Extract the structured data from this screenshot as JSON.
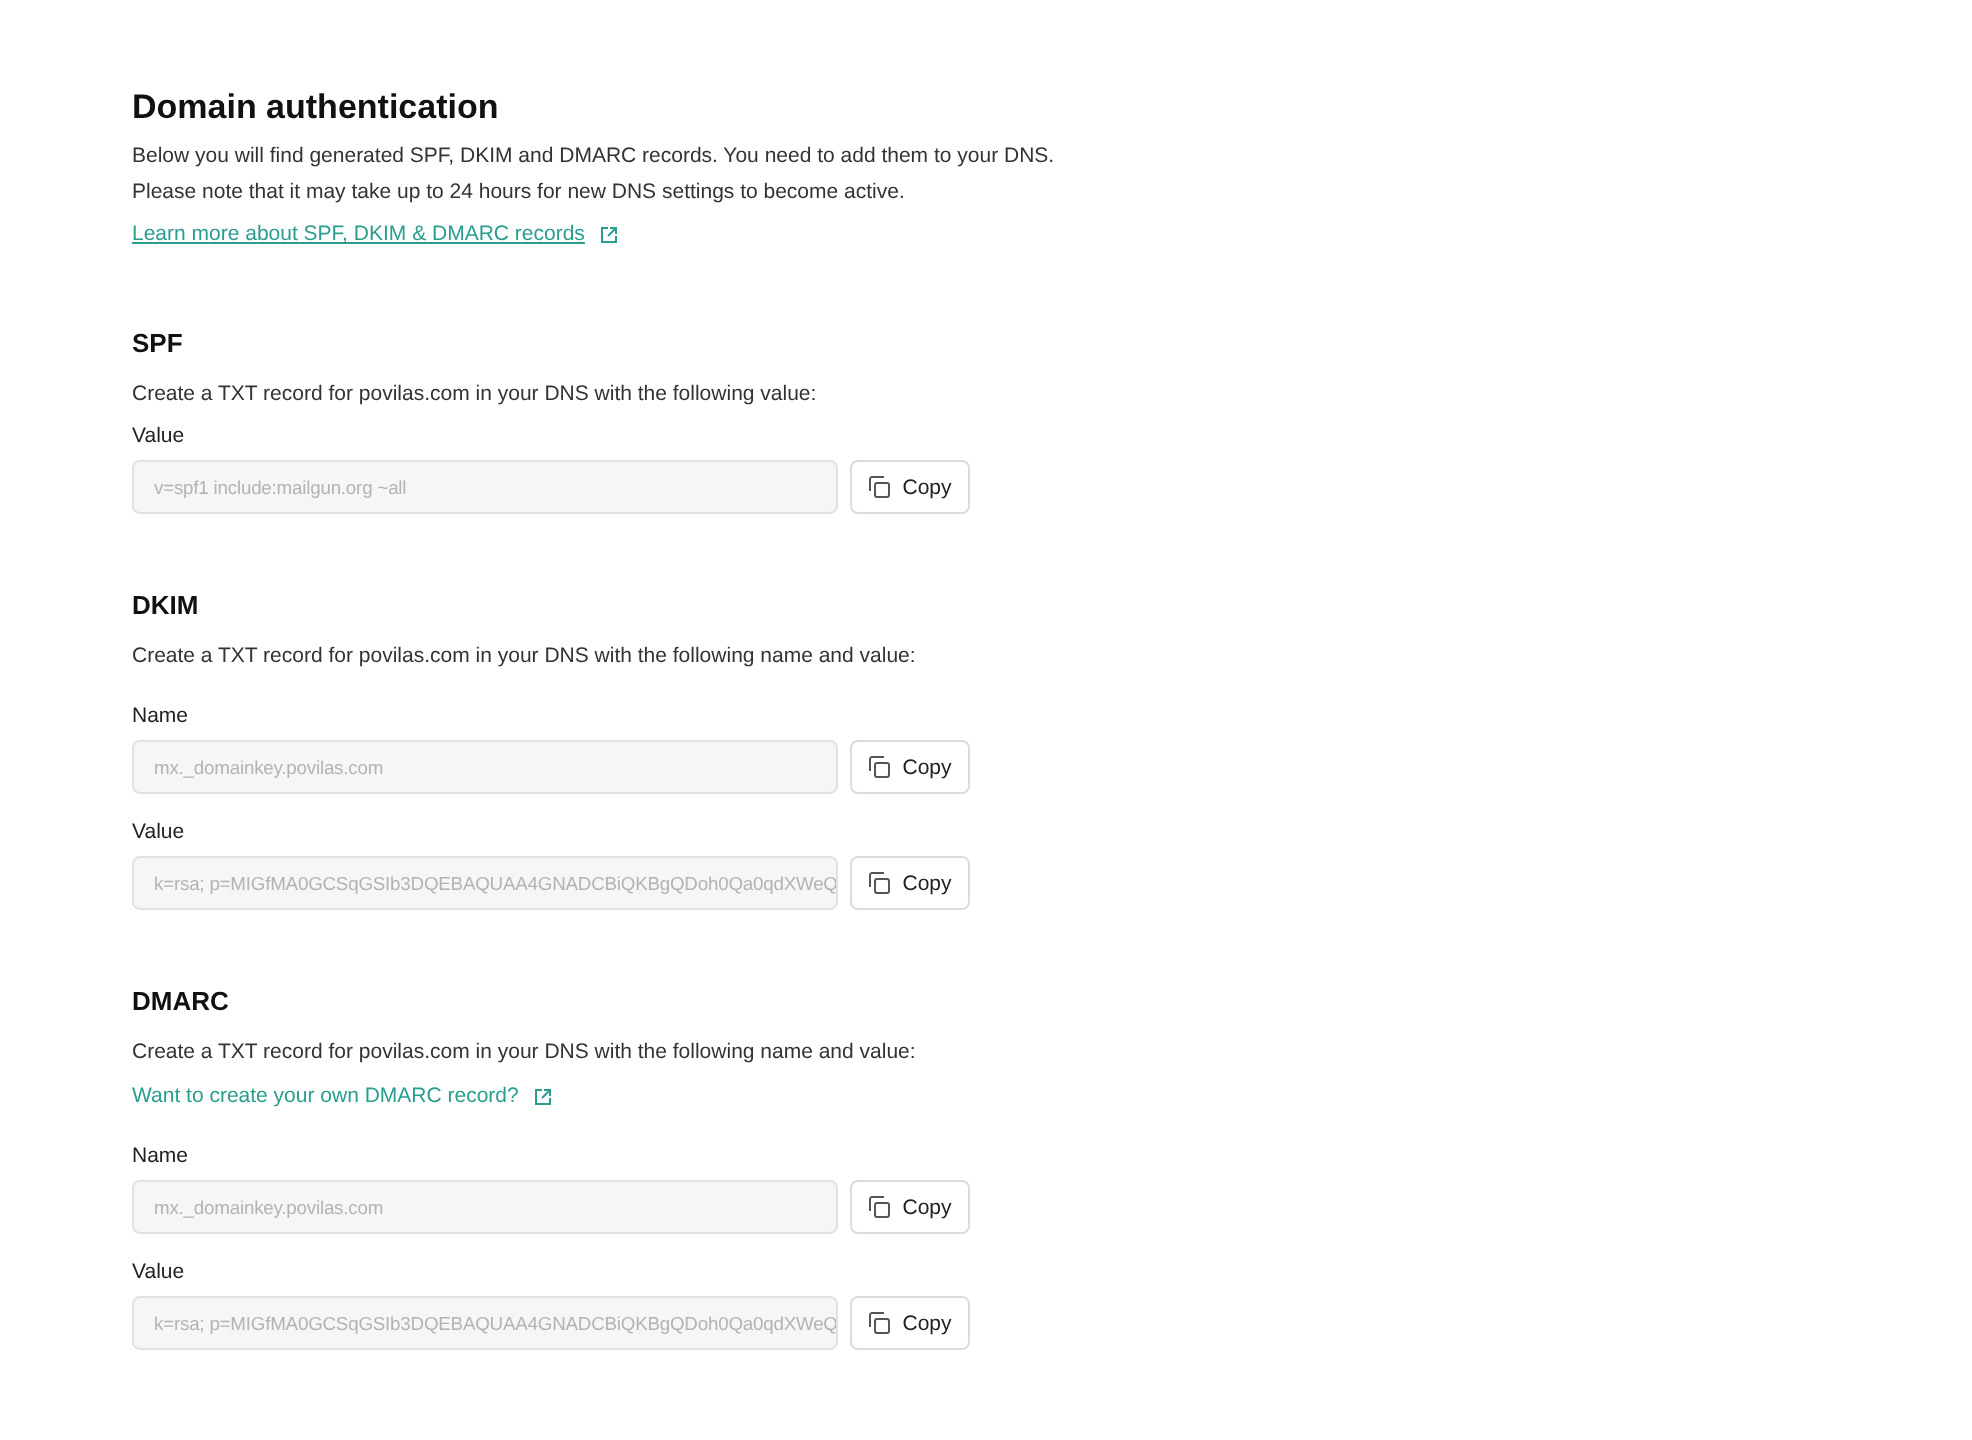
{
  "title": "Domain authentication",
  "intro": [
    "Below you will find generated SPF, DKIM and DMARC records. You need to add them to your DNS.",
    "Please note that it may take up to 24 hours for new DNS settings to become active."
  ],
  "intro_link": "Learn more about SPF, DKIM & DMARC records",
  "sections": [
    {
      "title": "SPF",
      "description": "Create a TXT record for povilas.com in your DNS with the following value:",
      "fields": [
        {
          "label": "Value",
          "value": "v=spf1 include:mailgun.org ~all",
          "button": "Copy"
        }
      ]
    },
    {
      "title": "DKIM",
      "description": "Create a TXT record for povilas.com in your DNS with the following name and value:",
      "fields": [
        {
          "label": "Name",
          "value": "mx._domainkey.povilas.com",
          "button": "Copy"
        },
        {
          "label": "Value",
          "value": "k=rsa; p=MIGfMA0GCSqGSIb3DQEBAQUAA4GNADCBiQKBgQDoh0Qa0qdXWeQ",
          "button": "Copy"
        }
      ]
    },
    {
      "title": "DMARC",
      "description": "Create a TXT record for povilas.com in your DNS with the following name and value:",
      "link": "Want to create your own DMARC record?",
      "fields": [
        {
          "label": "Name",
          "value": "mx._domainkey.povilas.com",
          "button": "Copy"
        },
        {
          "label": "Value",
          "value": "k=rsa; p=MIGfMA0GCSqGSIb3DQEBAQUAA4GNADCBiQKBgQDoh0Qa0qdXWeQ",
          "button": "Copy"
        }
      ]
    }
  ]
}
